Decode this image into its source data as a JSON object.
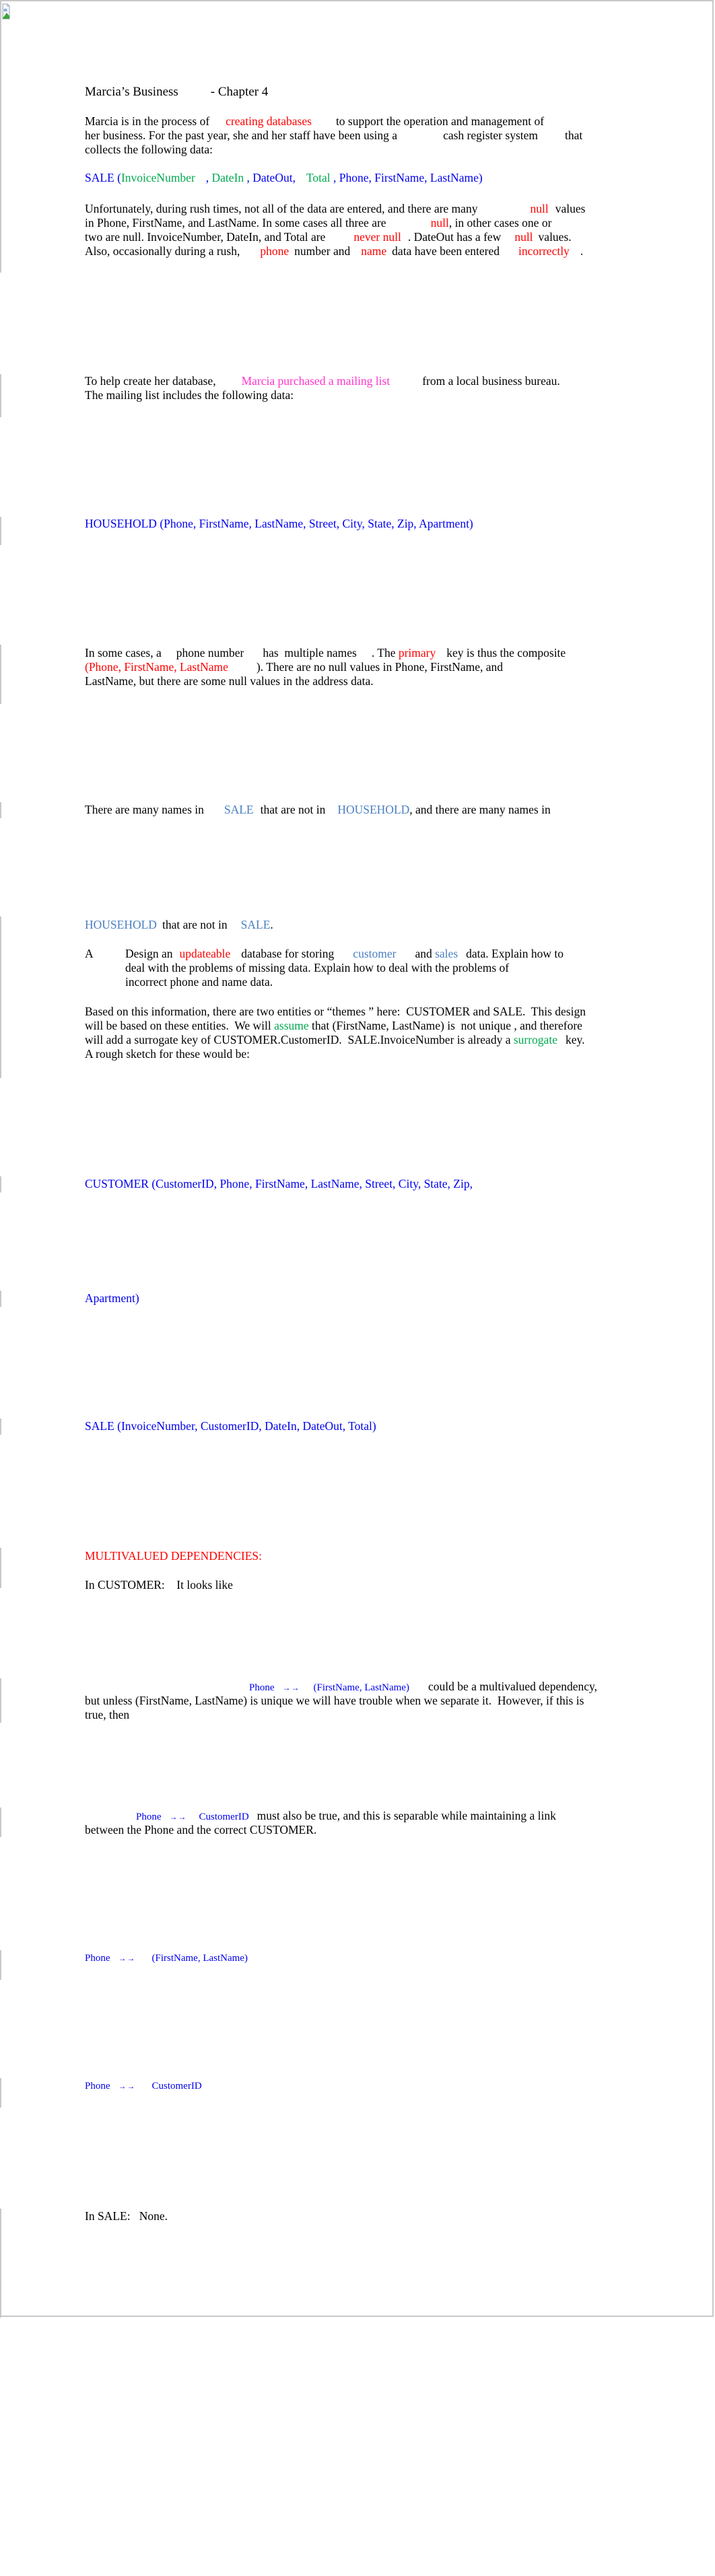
{
  "document": {
    "title_left": "Marcia’s Business",
    "title_right": "- Chapter 4",
    "intro": {
      "l1_a": "Marcia is in the process of",
      "l1_red": "creating databases",
      "l1_b": "to support the operation and management of",
      "l2_a": "her business. For the past year, she and her staff have been using a",
      "l2_b": "cash register system",
      "l2_c": "that",
      "l3": "collects the following data:"
    },
    "sale_schema": {
      "name": "SALE (",
      "invoice": "InvoiceNumber",
      "comma1": ",",
      "datein": "DateIn",
      "mid": ", DateOut,",
      "total": "Total",
      "rest": ", Phone, FirstName, LastName)"
    },
    "nulls": {
      "l1_a": "Unfortunately, during rush times, not all of the data are entered, and there are many",
      "l1_red": "null",
      "l1_b": "values",
      "l2_a": "in Phone, FirstName, and LastName. In some cases all three are",
      "l2_red": "null",
      "l2_b": ", in other cases one or",
      "l3_a": "two are null. InvoiceNumber, DateIn, and Total are",
      "l3_red1": "never null",
      "l3_b": ". DateOut has a few",
      "l3_red2": "null",
      "l3_c": "values.",
      "l4_a": "Also, occasionally during a rush,",
      "l4_red1": "phone",
      "l4_b": "number and",
      "l4_red2": "name",
      "l4_c": "data have been entered",
      "l4_red3": "incorrectly",
      "l4_d": "."
    },
    "mailing": {
      "l1_a": "To help create her database,",
      "l1_pink": "Marcia purchased a mailing list",
      "l1_b": "from a local business bureau.",
      "l2": "The mailing list includes the following data:"
    },
    "household_schema": "HOUSEHOLD (Phone, FirstName, LastName, Street, City, State, Zip, Apartment)",
    "composite": {
      "l1_a": "In some cases, a",
      "l1_b": "phone number",
      "l1_c": "has  multiple names",
      "l1_d": ". The",
      "l1_red": "primary",
      "l1_e": "key is thus the composite",
      "l2_red": "(Phone, FirstName, LastName",
      "l2_b": "). There are no null values in Phone, FirstName, and",
      "l3": "LastName, but there are some null values in the address data."
    },
    "names": {
      "l1_a": "There are many names in",
      "l1_sale": "SALE",
      "l1_b": "that are not in",
      "l1_household": "HOUSEHOLD",
      "l1_c": ", and there are many names in",
      "l2_household": "HOUSEHOLD",
      "l2_a": "that are not in",
      "l2_sale": "SALE",
      "l2_b": "."
    },
    "question": {
      "label": "A",
      "l1_a": "Design an",
      "l1_red": "updateable",
      "l1_b": "database for storing",
      "l1_customer": "customer",
      "l1_c": "and",
      "l1_sales": "sales",
      "l1_d": "data. Explain how to",
      "l2": "deal with the problems of missing data. Explain how to deal with the problems of",
      "l3": "incorrect phone and name data."
    },
    "answer": {
      "l1": "Based on this information, there are two entities or “themes ” here:  CUSTOMER and SALE.  This design",
      "l2_a": "will be based on these entities.  We will",
      "l2_green": "assume",
      "l2_b": "that (FirstName, LastName) is  not unique , and therefore",
      "l3_a": "will add a surrogate key of CUSTOMER.CustomerID.  SALE.InvoiceNumber is already a",
      "l3_green": "surrogate",
      "l3_b": "key.",
      "l4": "A rough sketch for these would be:"
    },
    "customer_schema_l1": "CUSTOMER (CustomerID, Phone, FirstName, LastName, Street, City, State, Zip,",
    "customer_schema_l2": "Apartment)",
    "sale_schema2": "SALE (InvoiceNumber, CustomerID, DateIn, DateOut, Total)",
    "mvd_heading": "MULTIVALUED DEPENDENCIES:",
    "in_customer": "In CUSTOMER:    It looks like",
    "mvd1": {
      "lhs": "Phone",
      "arrow": "→→",
      "rhs": "(FirstName, LastName)",
      "l1_b": "could be a multivalued dependency,",
      "l2": "but unless (FirstName, LastName) is unique we will have trouble when we separate it.  However, if this is",
      "l3": "true, then"
    },
    "mvd2": {
      "lhs": "Phone",
      "arrow": "→→",
      "rhs": "CustomerID",
      "l1_b": "must also be true, and this is separable while maintaining a link",
      "l2": "between the Phone and the correct CUSTOMER."
    },
    "mvd3": {
      "lhs": "Phone",
      "arrow": "→→",
      "rhs": "(FirstName, LastName)"
    },
    "mvd4": {
      "lhs": "Phone",
      "arrow": "→→",
      "rhs": "CustomerID"
    },
    "in_sale": "In SALE:   None."
  },
  "colors": {
    "red": "#ff0000",
    "green": "#00a94f",
    "blue": "#0000ee",
    "steel_blue": "#4a7fc1",
    "pink": "#ff33cc",
    "border": "#c8c8c8"
  }
}
